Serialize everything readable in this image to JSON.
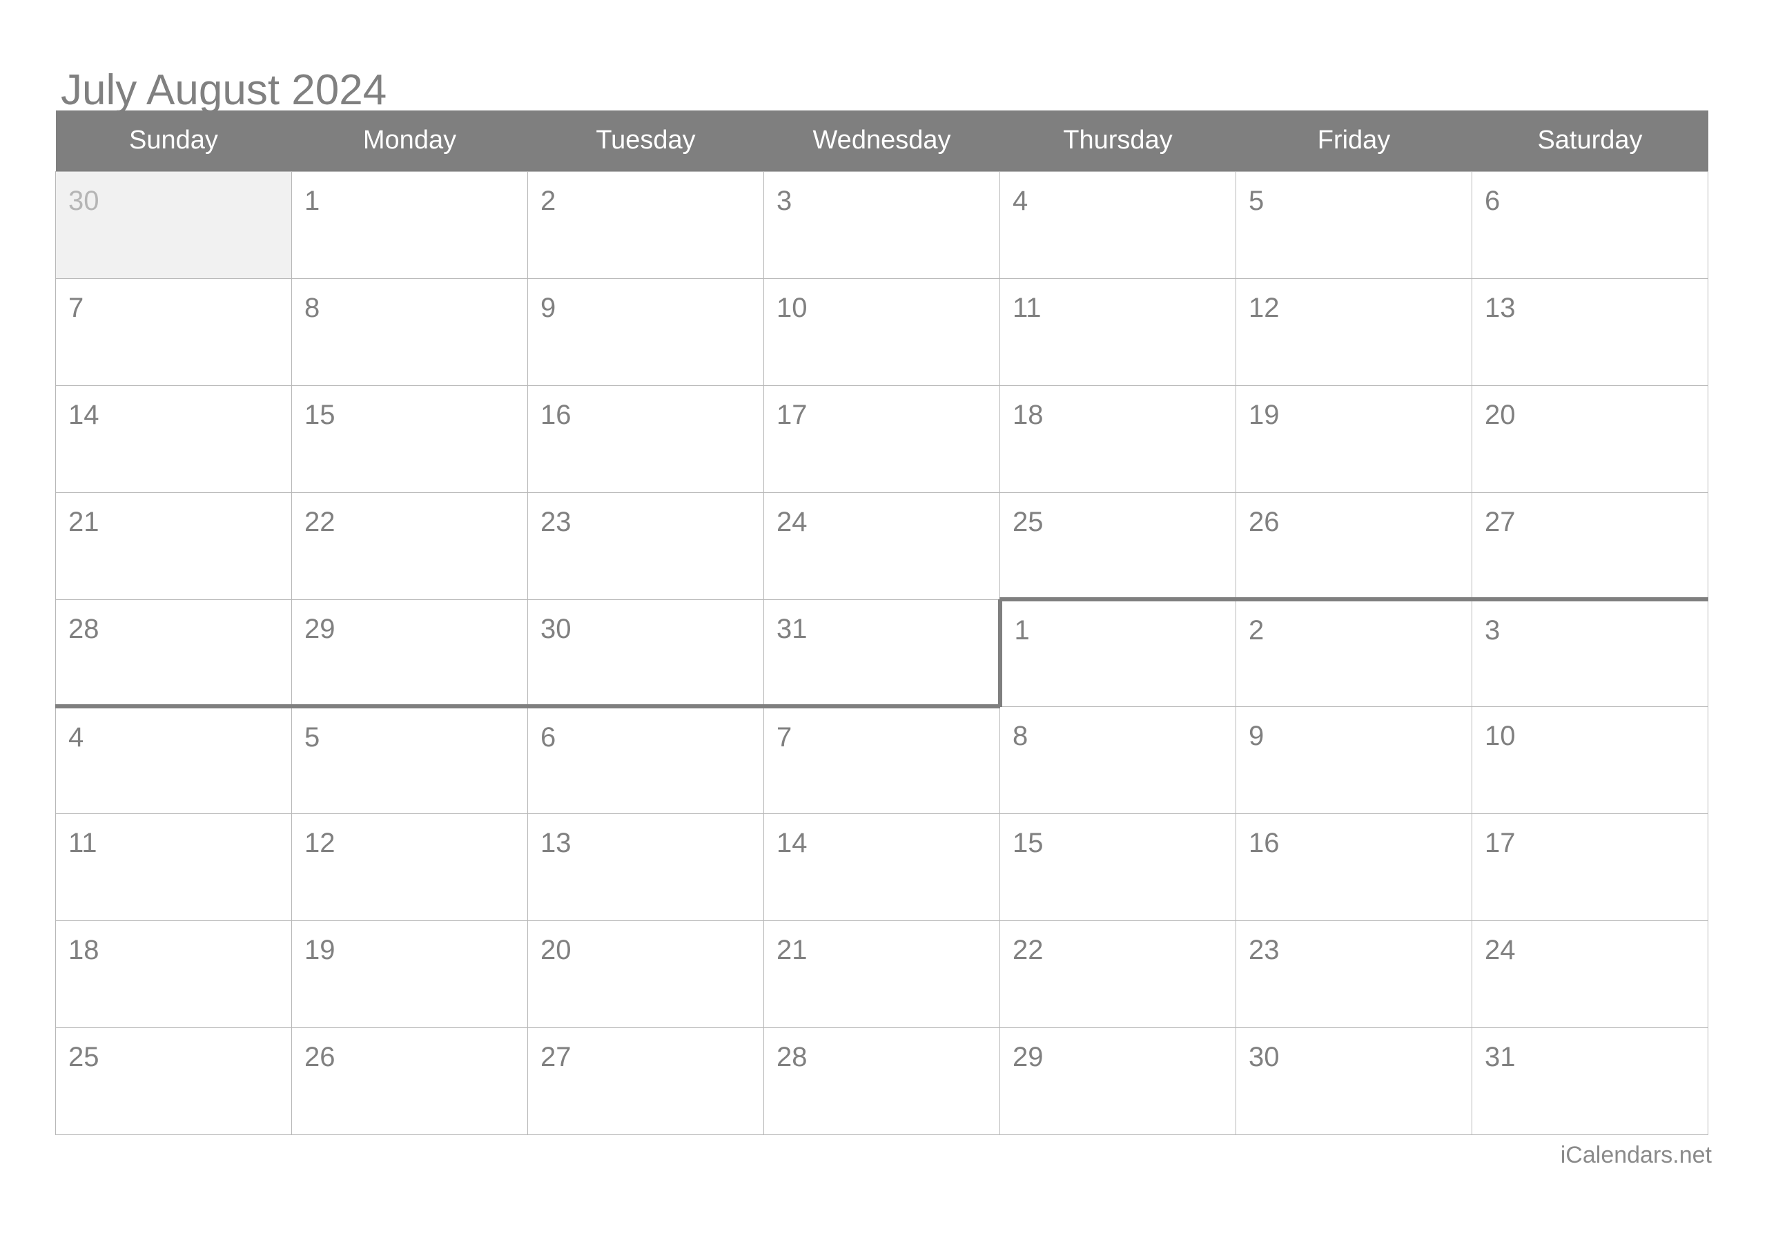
{
  "header": {
    "title": "July August 2024"
  },
  "colors": {
    "header_band": "#7f7f7f",
    "text_gray": "#808080",
    "muted_text": "#b5b5b5",
    "muted_cell_bg": "#f1f1f1",
    "grid_line": "#b8b8b8",
    "month_divider": "#7f7f7f",
    "page_bg": "#ffffff"
  },
  "weekdays": [
    {
      "label": "Sunday"
    },
    {
      "label": "Monday"
    },
    {
      "label": "Tuesday"
    },
    {
      "label": "Wednesday"
    },
    {
      "label": "Thursday"
    },
    {
      "label": "Friday"
    },
    {
      "label": "Saturday"
    }
  ],
  "weeks": [
    {
      "days": [
        {
          "num": "30",
          "muted": true,
          "borders": []
        },
        {
          "num": "1",
          "muted": false,
          "borders": []
        },
        {
          "num": "2",
          "muted": false,
          "borders": []
        },
        {
          "num": "3",
          "muted": false,
          "borders": []
        },
        {
          "num": "4",
          "muted": false,
          "borders": []
        },
        {
          "num": "5",
          "muted": false,
          "borders": []
        },
        {
          "num": "6",
          "muted": false,
          "borders": []
        }
      ]
    },
    {
      "days": [
        {
          "num": "7",
          "muted": false,
          "borders": []
        },
        {
          "num": "8",
          "muted": false,
          "borders": []
        },
        {
          "num": "9",
          "muted": false,
          "borders": []
        },
        {
          "num": "10",
          "muted": false,
          "borders": []
        },
        {
          "num": "11",
          "muted": false,
          "borders": []
        },
        {
          "num": "12",
          "muted": false,
          "borders": []
        },
        {
          "num": "13",
          "muted": false,
          "borders": []
        }
      ]
    },
    {
      "days": [
        {
          "num": "14",
          "muted": false,
          "borders": []
        },
        {
          "num": "15",
          "muted": false,
          "borders": []
        },
        {
          "num": "16",
          "muted": false,
          "borders": []
        },
        {
          "num": "17",
          "muted": false,
          "borders": []
        },
        {
          "num": "18",
          "muted": false,
          "borders": []
        },
        {
          "num": "19",
          "muted": false,
          "borders": []
        },
        {
          "num": "20",
          "muted": false,
          "borders": []
        }
      ]
    },
    {
      "days": [
        {
          "num": "21",
          "muted": false,
          "borders": []
        },
        {
          "num": "22",
          "muted": false,
          "borders": []
        },
        {
          "num": "23",
          "muted": false,
          "borders": []
        },
        {
          "num": "24",
          "muted": false,
          "borders": []
        },
        {
          "num": "25",
          "muted": false,
          "borders": []
        },
        {
          "num": "26",
          "muted": false,
          "borders": []
        },
        {
          "num": "27",
          "muted": false,
          "borders": []
        }
      ]
    },
    {
      "days": [
        {
          "num": "28",
          "muted": false,
          "borders": [
            "mb-bottom"
          ]
        },
        {
          "num": "29",
          "muted": false,
          "borders": [
            "mb-bottom"
          ]
        },
        {
          "num": "30",
          "muted": false,
          "borders": [
            "mb-bottom"
          ]
        },
        {
          "num": "31",
          "muted": false,
          "borders": [
            "mb-bottom"
          ]
        },
        {
          "num": "1",
          "muted": false,
          "borders": [
            "mb-top",
            "mb-left"
          ]
        },
        {
          "num": "2",
          "muted": false,
          "borders": [
            "mb-top"
          ]
        },
        {
          "num": "3",
          "muted": false,
          "borders": [
            "mb-top"
          ]
        }
      ]
    },
    {
      "days": [
        {
          "num": "4",
          "muted": false,
          "borders": []
        },
        {
          "num": "5",
          "muted": false,
          "borders": []
        },
        {
          "num": "6",
          "muted": false,
          "borders": []
        },
        {
          "num": "7",
          "muted": false,
          "borders": []
        },
        {
          "num": "8",
          "muted": false,
          "borders": []
        },
        {
          "num": "9",
          "muted": false,
          "borders": []
        },
        {
          "num": "10",
          "muted": false,
          "borders": []
        }
      ]
    },
    {
      "days": [
        {
          "num": "11",
          "muted": false,
          "borders": []
        },
        {
          "num": "12",
          "muted": false,
          "borders": []
        },
        {
          "num": "13",
          "muted": false,
          "borders": []
        },
        {
          "num": "14",
          "muted": false,
          "borders": []
        },
        {
          "num": "15",
          "muted": false,
          "borders": []
        },
        {
          "num": "16",
          "muted": false,
          "borders": []
        },
        {
          "num": "17",
          "muted": false,
          "borders": []
        }
      ]
    },
    {
      "days": [
        {
          "num": "18",
          "muted": false,
          "borders": []
        },
        {
          "num": "19",
          "muted": false,
          "borders": []
        },
        {
          "num": "20",
          "muted": false,
          "borders": []
        },
        {
          "num": "21",
          "muted": false,
          "borders": []
        },
        {
          "num": "22",
          "muted": false,
          "borders": []
        },
        {
          "num": "23",
          "muted": false,
          "borders": []
        },
        {
          "num": "24",
          "muted": false,
          "borders": []
        }
      ]
    },
    {
      "days": [
        {
          "num": "25",
          "muted": false,
          "borders": []
        },
        {
          "num": "26",
          "muted": false,
          "borders": []
        },
        {
          "num": "27",
          "muted": false,
          "borders": []
        },
        {
          "num": "28",
          "muted": false,
          "borders": []
        },
        {
          "num": "29",
          "muted": false,
          "borders": []
        },
        {
          "num": "30",
          "muted": false,
          "borders": []
        },
        {
          "num": "31",
          "muted": false,
          "borders": []
        }
      ]
    }
  ],
  "footer": {
    "credit": "iCalendars.net"
  }
}
